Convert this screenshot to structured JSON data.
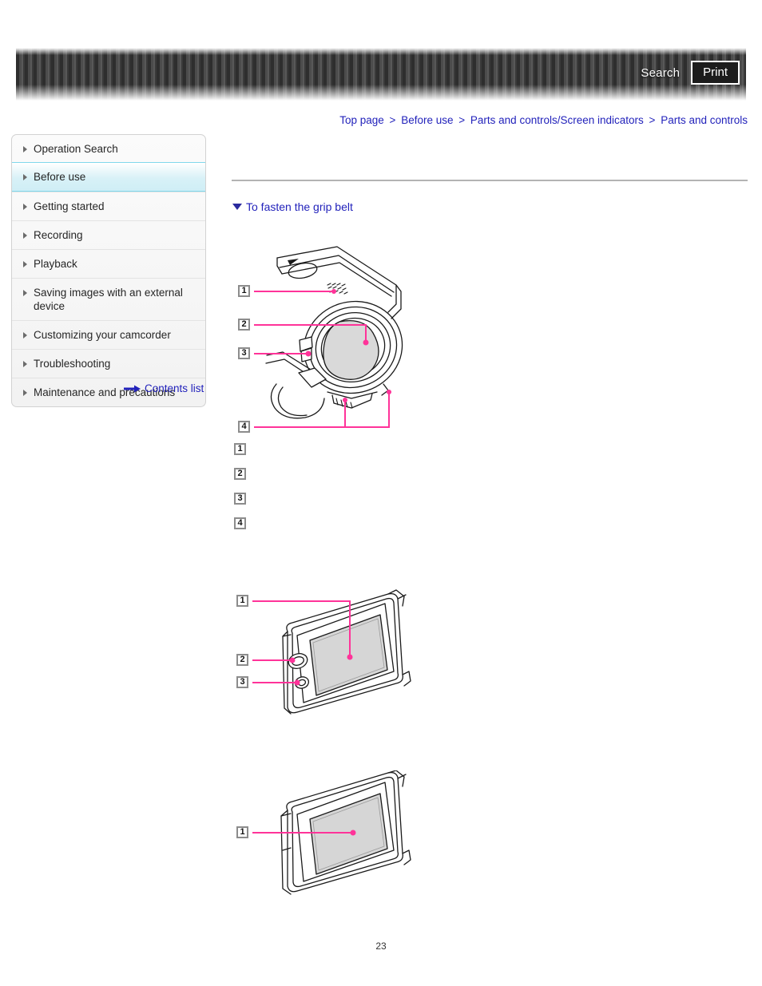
{
  "header": {
    "search_label": "Search",
    "print_label": "Print"
  },
  "breadcrumb": {
    "separator": ">",
    "items": [
      {
        "label": "Top page"
      },
      {
        "label": "Before use"
      },
      {
        "label": "Parts and controls/Screen indicators"
      },
      {
        "label": "Parts and controls"
      }
    ]
  },
  "sidebar": {
    "items": [
      {
        "label": "Operation Search",
        "active": false
      },
      {
        "label": "Before use",
        "active": true
      },
      {
        "label": "Getting started",
        "active": false
      },
      {
        "label": "Recording",
        "active": false
      },
      {
        "label": "Playback",
        "active": false
      },
      {
        "label": "Saving images with an external device",
        "active": false
      },
      {
        "label": "Customizing your camcorder",
        "active": false
      },
      {
        "label": "Troubleshooting",
        "active": false
      },
      {
        "label": "Maintenance and precautions",
        "active": false
      }
    ],
    "contents_list_label": "Contents list"
  },
  "main": {
    "section_heading": "To fasten the grip belt",
    "parts_list": [
      {
        "number": "1",
        "text": ""
      },
      {
        "number": "2",
        "text": ""
      },
      {
        "number": "3",
        "text": ""
      },
      {
        "number": "4",
        "text": ""
      }
    ],
    "figures": [
      {
        "name": "camcorder-front-view",
        "callouts": [
          "1",
          "2",
          "3",
          "4"
        ]
      },
      {
        "name": "camcorder-lcd-panel-open",
        "callouts": [
          "1",
          "2",
          "3"
        ]
      },
      {
        "name": "camcorder-lcd-panel",
        "callouts": [
          "1"
        ]
      }
    ]
  },
  "footer": {
    "page_number": "23"
  },
  "colors": {
    "link": "#2222bb",
    "callout_line": "#ff3399",
    "active_nav": "#cfeef6",
    "header_dark": "#2e2e2e"
  }
}
